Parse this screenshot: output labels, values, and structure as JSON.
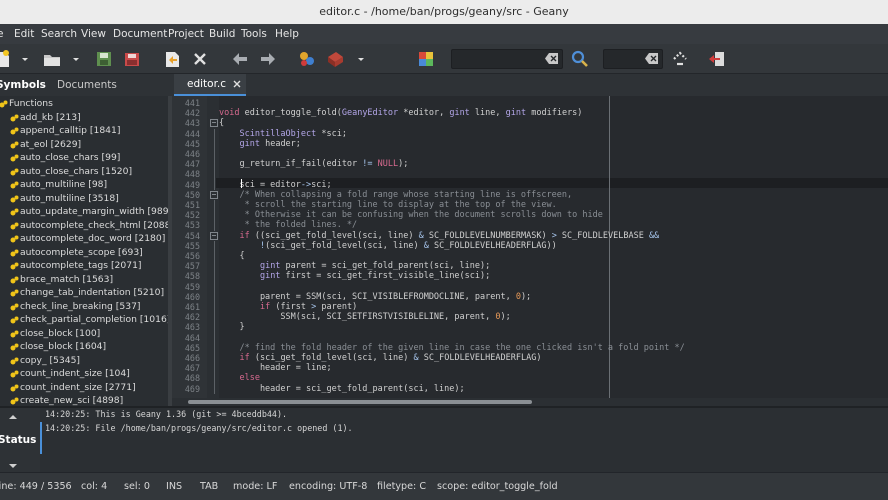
{
  "window": {
    "title": "editor.c - /home/ban/progs/geany/src - Geany"
  },
  "menu": [
    "e",
    "Edit",
    "Search",
    "View",
    "Document",
    "Project",
    "Build",
    "Tools",
    "Help"
  ],
  "toolbar": {
    "icons": [
      "new-file-icon",
      "open-file-icon",
      "save-icon",
      "save-all-icon",
      "revert-icon",
      "close-icon",
      "back-icon",
      "forward-icon",
      "compile-icon",
      "build-icon",
      "color-chooser-icon",
      "search-icon",
      "jump-to-line-icon",
      "quit-icon"
    ],
    "search_value": "",
    "goto_value": ""
  },
  "sidebar": {
    "tabs": [
      "Symbols",
      "Documents"
    ],
    "group": "Functions",
    "symbols": [
      "add_kb [213]",
      "append_calltip [1841]",
      "at_eol [2629]",
      "auto_close_chars [99]",
      "auto_close_chars [1520]",
      "auto_multiline [98]",
      "auto_multiline [3518]",
      "auto_update_margin_width [989]",
      "autocomplete_check_html [2088]",
      "autocomplete_doc_word [2180]",
      "autocomplete_scope [693]",
      "autocomplete_tags [2071]",
      "brace_match [1563]",
      "change_tab_indentation [5210]",
      "check_line_breaking [537]",
      "check_partial_completion [1016]",
      "close_block [100]",
      "close_block [1604]",
      "copy_ [5345]",
      "count_indent_size [104]",
      "count_indent_size [2771]",
      "create_new_sci [4898]"
    ]
  },
  "editor": {
    "tab_label": "editor.c",
    "line_numbers": [
      "441",
      "442",
      "443",
      "444",
      "445",
      "446",
      "447",
      "448",
      "449",
      "450",
      "451",
      "452",
      "453",
      "454",
      "455",
      "456",
      "457",
      "458",
      "459",
      "460",
      "461",
      "462",
      "463",
      "464",
      "465",
      "466",
      "467",
      "468",
      "469"
    ],
    "code": [
      [],
      [
        [
          "void",
          "kw"
        ],
        [
          " editor_toggle_fold(",
          ""
        ],
        [
          "GeanyEditor",
          "ty"
        ],
        [
          " *editor, ",
          ""
        ],
        [
          "gint",
          "ty"
        ],
        [
          " line, ",
          ""
        ],
        [
          "gint",
          "ty"
        ],
        [
          " modifiers)",
          ""
        ]
      ],
      [
        [
          "{",
          ""
        ]
      ],
      [
        [
          "    ",
          ""
        ],
        [
          "ScintillaObject",
          "ty"
        ],
        [
          " *sci;",
          ""
        ]
      ],
      [
        [
          "    ",
          ""
        ],
        [
          "gint",
          "ty"
        ],
        [
          " header;",
          ""
        ]
      ],
      [],
      [
        [
          "    g_return_if_fail(editor ",
          ""
        ],
        [
          "!=",
          "op"
        ],
        [
          " ",
          ""
        ],
        [
          "NULL",
          "kw"
        ],
        [
          ");",
          ""
        ]
      ],
      [],
      [
        [
          "    sci = editor",
          ""
        ],
        [
          "->",
          "op"
        ],
        [
          "sci;",
          ""
        ]
      ],
      [
        [
          "    /* When collapsing a fold range whose starting line is offscreen,",
          "cm"
        ]
      ],
      [
        [
          "     * scroll the starting line to display at the top of the view.",
          "cm"
        ]
      ],
      [
        [
          "     * Otherwise it can be confusing when the document scrolls down to hide",
          "cm"
        ]
      ],
      [
        [
          "     * the folded lines. */",
          "cm"
        ]
      ],
      [
        [
          "    ",
          ""
        ],
        [
          "if",
          "kw"
        ],
        [
          " ((sci_get_fold_level(sci, line) ",
          ""
        ],
        [
          "&",
          "op"
        ],
        [
          " SC_FOLDLEVELNUMBERMASK) ",
          ""
        ],
        [
          ">",
          "op"
        ],
        [
          " SC_FOLDLEVELBASE ",
          ""
        ],
        [
          "&&",
          "op"
        ]
      ],
      [
        [
          "        ",
          ""
        ],
        [
          "!",
          "op"
        ],
        [
          "(sci_get_fold_level(sci, line) ",
          ""
        ],
        [
          "&",
          "op"
        ],
        [
          " SC_FOLDLEVELHEADERFLAG))",
          ""
        ]
      ],
      [
        [
          "    {",
          ""
        ]
      ],
      [
        [
          "        ",
          ""
        ],
        [
          "gint",
          "ty"
        ],
        [
          " parent = sci_get_fold_parent(sci, line);",
          ""
        ]
      ],
      [
        [
          "        ",
          ""
        ],
        [
          "gint",
          "ty"
        ],
        [
          " first = sci_get_first_visible_line(sci);",
          ""
        ]
      ],
      [],
      [
        [
          "        parent = SSM(sci, SCI_VISIBLEFROMDOCLINE, parent, ",
          ""
        ],
        [
          "0",
          "nu"
        ],
        [
          ");",
          ""
        ]
      ],
      [
        [
          "        ",
          ""
        ],
        [
          "if",
          "kw"
        ],
        [
          " (first ",
          ""
        ],
        [
          ">",
          "op"
        ],
        [
          " parent)",
          ""
        ]
      ],
      [
        [
          "            SSM(sci, SCI_SETFIRSTVISIBLELINE, parent, ",
          ""
        ],
        [
          "0",
          "nu"
        ],
        [
          ");",
          ""
        ]
      ],
      [
        [
          "    }",
          ""
        ]
      ],
      [],
      [
        [
          "    /* find the fold header of the given line in case the one clicked isn't a fold point */",
          "cm"
        ]
      ],
      [
        [
          "    ",
          ""
        ],
        [
          "if",
          "kw"
        ],
        [
          " (sci_get_fold_level(sci, line) ",
          ""
        ],
        [
          "&",
          "op"
        ],
        [
          " SC_FOLDLEVELHEADERFLAG)",
          ""
        ]
      ],
      [
        [
          "        header = line;",
          ""
        ]
      ],
      [
        [
          "    ",
          ""
        ],
        [
          "else",
          "kw"
        ]
      ],
      [
        [
          "        header = sci_get_fold_parent(sci, line);",
          ""
        ]
      ]
    ]
  },
  "messages": {
    "tab": "Status",
    "lines": [
      "14:20:25: This is Geany 1.36 (git >= 4bceddb44).",
      "14:20:25: File /home/ban/progs/geany/src/editor.c opened (1)."
    ]
  },
  "status": {
    "line": "line: 449 / 5356",
    "col": "col: 4",
    "sel": "sel: 0",
    "ins": "INS",
    "tab": "TAB",
    "mode": "mode: LF",
    "encoding": "encoding: UTF-8",
    "filetype": "filetype: C",
    "scope": "scope: editor_toggle_fold"
  },
  "colors": {
    "accent": "#4a90d9",
    "keyword": "#d76a8f",
    "type": "#b3a6e8",
    "comment": "#8a8f95",
    "number": "#e89a58",
    "symbol_icon": "#f0c419"
  }
}
